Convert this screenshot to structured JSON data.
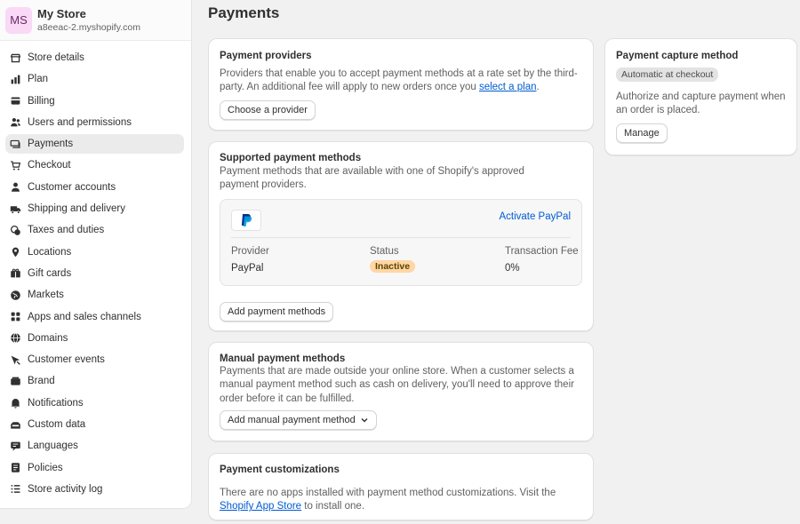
{
  "store": {
    "initials": "MS",
    "name": "My Store",
    "domain": "a8eeac-2.myshopify.com"
  },
  "sidebar": {
    "items": [
      {
        "label": "Store details",
        "icon": "store-icon"
      },
      {
        "label": "Plan",
        "icon": "plan-icon"
      },
      {
        "label": "Billing",
        "icon": "billing-icon"
      },
      {
        "label": "Users and permissions",
        "icon": "users-icon"
      },
      {
        "label": "Payments",
        "icon": "payments-icon",
        "active": true
      },
      {
        "label": "Checkout",
        "icon": "cart-icon"
      },
      {
        "label": "Customer accounts",
        "icon": "person-icon"
      },
      {
        "label": "Shipping and delivery",
        "icon": "truck-icon"
      },
      {
        "label": "Taxes and duties",
        "icon": "taxes-icon"
      },
      {
        "label": "Locations",
        "icon": "location-icon"
      },
      {
        "label": "Gift cards",
        "icon": "gift-icon"
      },
      {
        "label": "Markets",
        "icon": "globe-icon"
      },
      {
        "label": "Apps and sales channels",
        "icon": "apps-icon"
      },
      {
        "label": "Domains",
        "icon": "domain-icon"
      },
      {
        "label": "Customer events",
        "icon": "events-icon"
      },
      {
        "label": "Brand",
        "icon": "brand-icon"
      },
      {
        "label": "Notifications",
        "icon": "bell-icon"
      },
      {
        "label": "Custom data",
        "icon": "data-icon"
      },
      {
        "label": "Languages",
        "icon": "language-icon"
      },
      {
        "label": "Policies",
        "icon": "policy-icon"
      },
      {
        "label": "Store activity log",
        "icon": "list-icon"
      }
    ]
  },
  "page": {
    "title": "Payments"
  },
  "providers": {
    "title": "Payment providers",
    "text_before": "Providers that enable you to accept payment methods at a rate set by the third-party. An additional fee will apply to new orders once you ",
    "link": "select a plan",
    "text_after": ".",
    "button": "Choose a provider"
  },
  "supported": {
    "title": "Supported payment methods",
    "text": "Payment methods that are available with one of Shopify's approved payment providers.",
    "activate": "Activate PayPal",
    "columns": {
      "provider": "Provider",
      "status": "Status",
      "fee": "Transaction Fee"
    },
    "row": {
      "provider": "PayPal",
      "status": "Inactive",
      "fee": "0%"
    },
    "button": "Add payment methods"
  },
  "manual": {
    "title": "Manual payment methods",
    "text": "Payments that are made outside your online store. When a customer selects a manual payment method such as cash on delivery, you'll need to approve their order before it can be fulfilled.",
    "button": "Add manual payment method"
  },
  "customizations": {
    "title": "Payment customizations",
    "text_before": "There are no apps installed with payment method customizations. Visit the ",
    "link": "Shopify App Store",
    "text_after": " to install one."
  },
  "capture": {
    "title": "Payment capture method",
    "badge": "Automatic at checkout",
    "text": "Authorize and capture payment when an order is placed.",
    "button": "Manage"
  },
  "colors": {
    "accent": "#005bd3",
    "badge_inactive": "#ffd6a4",
    "avatar": "#f9d9f6"
  }
}
